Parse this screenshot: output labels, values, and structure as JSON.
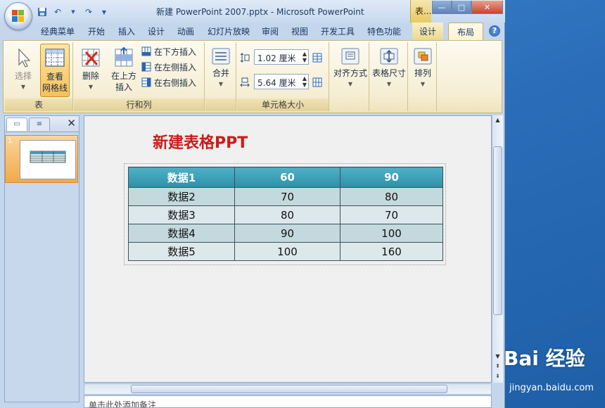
{
  "window": {
    "title": "新建 PowerPoint 2007.pptx - Microsoft PowerPoint",
    "context_title": "表...",
    "controls": {
      "minimize": "—",
      "maximize": "□",
      "close": "✕"
    }
  },
  "quick_access": {
    "save_icon": "save-icon",
    "undo_icon": "undo-icon",
    "redo_icon": "redo-icon",
    "customize": "▼"
  },
  "tabs": [
    {
      "label": "经典菜单"
    },
    {
      "label": "开始"
    },
    {
      "label": "插入"
    },
    {
      "label": "设计"
    },
    {
      "label": "动画"
    },
    {
      "label": "幻灯片放映"
    },
    {
      "label": "审阅"
    },
    {
      "label": "视图"
    },
    {
      "label": "开发工具"
    },
    {
      "label": "特色功能"
    },
    {
      "label": "设计"
    },
    {
      "label": "布局"
    }
  ],
  "help": "?",
  "ribbon": {
    "table_group": {
      "label": "表",
      "select": "选择",
      "view_gridlines_1": "查看",
      "view_gridlines_2": "网格线"
    },
    "rows_cols_group": {
      "label": "行和列",
      "delete": "删除",
      "insert_above_1": "在上方",
      "insert_above_2": "插入",
      "insert_below": "在下方插入",
      "insert_left": "在左侧插入",
      "insert_right": "在右侧插入"
    },
    "merge_group": {
      "merge": "合并"
    },
    "cell_size_group": {
      "label": "单元格大小",
      "height_value": "1.02 厘米",
      "width_value": "5.64 厘米"
    },
    "align": "对齐方式",
    "table_size": "表格尺寸",
    "arrange": "排列"
  },
  "left_pane": {
    "slide_number": "1",
    "close": "✕"
  },
  "slide": {
    "title": "新建表格PPT",
    "table": {
      "rows": [
        [
          "数据1",
          "60",
          "90"
        ],
        [
          "数据2",
          "70",
          "80"
        ],
        [
          "数据3",
          "80",
          "70"
        ],
        [
          "数据4",
          "90",
          "100"
        ],
        [
          "数据5",
          "100",
          "160"
        ]
      ]
    }
  },
  "notes": {
    "placeholder": "单击此处添加备注"
  },
  "watermark": {
    "brand": "Bai  经验",
    "url": "jingyan.baidu.com"
  },
  "colors": {
    "header_teal": "#3a9eb6",
    "accent_orange": "#f2a94b",
    "title_red": "#cc1b1b"
  }
}
